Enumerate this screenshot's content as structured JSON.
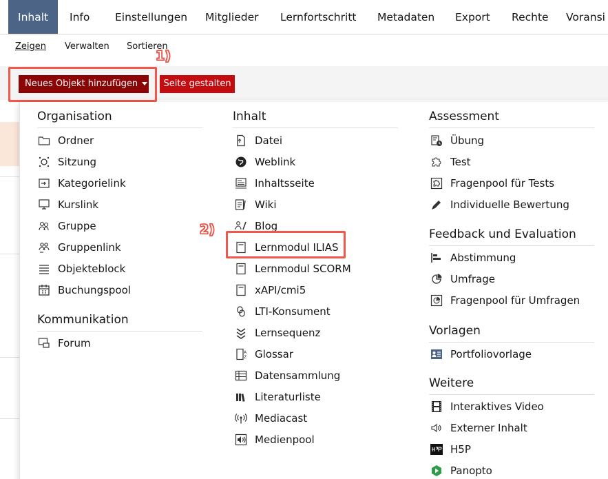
{
  "tabs": [
    "Inhalt",
    "Info",
    "Einstellungen",
    "Mitglieder",
    "Lernfortschritt",
    "Metadaten",
    "Export",
    "Rechte",
    "Voransi"
  ],
  "subtabs": [
    "Zeigen",
    "Verwalten",
    "Sortieren"
  ],
  "toolbar": {
    "add_label": "Neues Objekt hinzufügen",
    "design_label": "Seite gestalten"
  },
  "markers": [
    "1)",
    "2)"
  ],
  "groups": {
    "organisation": {
      "title": "Organisation",
      "items": [
        "Ordner",
        "Sitzung",
        "Kategorielink",
        "Kurslink",
        "Gruppe",
        "Gruppenlink",
        "Objekteblock",
        "Buchungspool"
      ]
    },
    "kommunikation": {
      "title": "Kommunikation",
      "items": [
        "Forum"
      ]
    },
    "inhalt": {
      "title": "Inhalt",
      "items": [
        "Datei",
        "Weblink",
        "Inhaltsseite",
        "Wiki",
        "Blog",
        "Lernmodul ILIAS",
        "Lernmodul SCORM",
        "xAPI/cmi5",
        "LTI-Konsument",
        "Lernsequenz",
        "Glossar",
        "Datensammlung",
        "Literaturliste",
        "Mediacast",
        "Medienpool"
      ]
    },
    "assessment": {
      "title": "Assessment",
      "items": [
        "Übung",
        "Test",
        "Fragenpool für Tests",
        "Individuelle Bewertung"
      ]
    },
    "feedback": {
      "title": "Feedback und Evaluation",
      "items": [
        "Abstimmung",
        "Umfrage",
        "Fragenpool für Umfragen"
      ]
    },
    "vorlagen": {
      "title": "Vorlagen",
      "items": [
        "Portfoliovorlage"
      ]
    },
    "weitere": {
      "title": "Weitere",
      "items": [
        "Interaktives Video",
        "Externer Inhalt",
        "H5P",
        "Panopto"
      ]
    }
  },
  "colors": {
    "tab_active": "#4c6586",
    "add_button": "#8c0405",
    "design_button": "#c40b10",
    "highlight": "#f0584c"
  }
}
